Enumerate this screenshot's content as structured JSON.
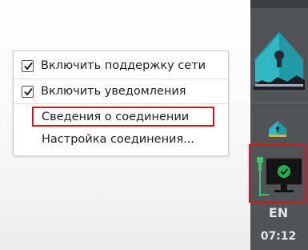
{
  "menu": {
    "items": [
      {
        "label": "Включить поддержку сети",
        "checked": true
      },
      {
        "label": "Включить уведомления",
        "checked": true
      },
      {
        "label": "Сведения о соединении",
        "highlighted": true
      },
      {
        "label": "Настройка соединения..."
      }
    ]
  },
  "taskbar": {
    "app_icon": "house-keyhole-icon",
    "tray_icon": "update-notifier-icon",
    "network_icon": "network-connected-icon",
    "language": "EN",
    "clock": "07:12"
  },
  "colors": {
    "highlight_border": "#d9141d",
    "taskbar_bg": "#525357",
    "accent_teal": "#2fb7c4",
    "connected_green": "#22b14c"
  }
}
